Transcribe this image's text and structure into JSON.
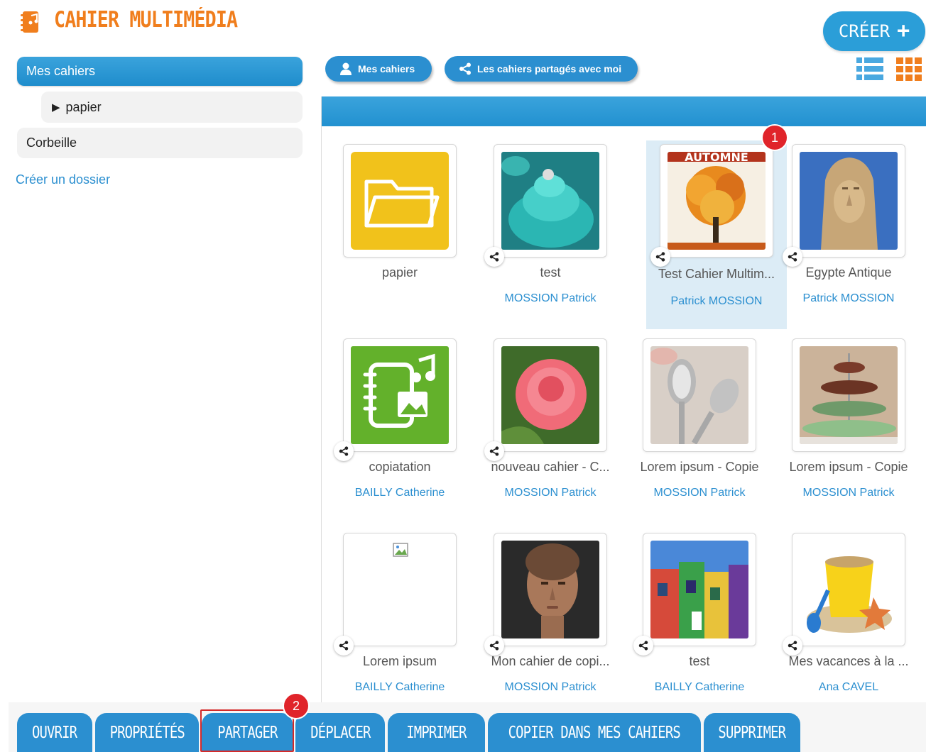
{
  "app": {
    "title": "CAHIER MULTIMÉDIA",
    "logo_icon": "notebook-logo-icon",
    "accent": "#f07e1d"
  },
  "header": {
    "create_label": "CRÉER",
    "create_plus": "+"
  },
  "sidebar": {
    "items": [
      {
        "label": "Mes cahiers",
        "active": true
      },
      {
        "label": "papier",
        "expander": "▶"
      },
      {
        "label": "Corbeille"
      }
    ],
    "create_folder": "Créer un dossier"
  },
  "filters": {
    "mine": "Mes cahiers",
    "shared": "Les cahiers partagés avec moi"
  },
  "view_modes": [
    "list",
    "grid"
  ],
  "cards": [
    {
      "title": "papier",
      "owner": "",
      "thumb": "folder",
      "shared": false
    },
    {
      "title": "test",
      "owner": "MOSSION Patrick",
      "thumb": "teal-cupcake",
      "shared": true
    },
    {
      "title": "Test Cahier Multim...",
      "owner": "Patrick MOSSION",
      "thumb": "autumn-tree",
      "shared": true,
      "selected": true,
      "thumb_text": "AUTOMNE"
    },
    {
      "title": "Egypte Antique",
      "owner": "Patrick MOSSION",
      "thumb": "pharaoh-statue",
      "shared": true
    },
    {
      "title": "copiatation",
      "owner": "BAILLY Catherine",
      "thumb": "notebook-green",
      "shared": true
    },
    {
      "title": "nouveau cahier - C...",
      "owner": "MOSSION Patrick",
      "thumb": "pink-rose",
      "shared": true
    },
    {
      "title": "Lorem ipsum - Copie",
      "owner": "MOSSION Patrick",
      "thumb": "spoons",
      "shared": false
    },
    {
      "title": "Lorem ipsum - Copie",
      "owner": "MOSSION Patrick",
      "thumb": "cupcake-tower",
      "shared": false
    },
    {
      "title": "Lorem ipsum",
      "owner": "BAILLY Catherine",
      "thumb": "broken-image",
      "shared": true
    },
    {
      "title": "Mon cahier de copi...",
      "owner": "MOSSION Patrick",
      "thumb": "face-portrait",
      "shared": true
    },
    {
      "title": "test",
      "owner": "BAILLY Catherine",
      "thumb": "colorful-houses",
      "shared": true
    },
    {
      "title": "Mes vacances à la ...",
      "owner": "Ana CAVEL",
      "thumb": "sand-bucket",
      "shared": true
    }
  ],
  "steps": [
    "1",
    "2"
  ],
  "toolbar": {
    "buttons": [
      "OUVRIR",
      "PROPRIÉTÉS",
      "PARTAGER",
      "DÉPLACER",
      "IMPRIMER",
      "COPIER DANS MES CAHIERS",
      "SUPPRIMER"
    ]
  }
}
